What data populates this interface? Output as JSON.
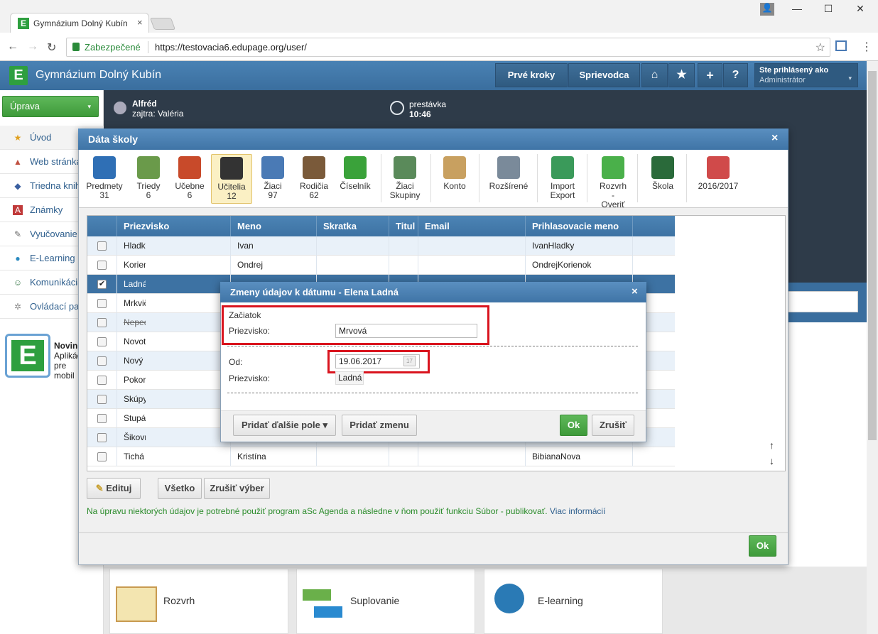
{
  "browser": {
    "tab_title": "Gymnázium Dolný Kubín",
    "tab_close": "×",
    "secure_label": "Zabezpečené",
    "url": "https://testovacia6.edupage.org/user/",
    "minimize": "—",
    "maximize": "☐",
    "close": "✕"
  },
  "header": {
    "logo_letter": "E",
    "title": "Gymnázium Dolný Kubín",
    "first_steps": "Prvé kroky",
    "guide": "Sprievodca",
    "home_icon": "⌂",
    "star_icon": "★",
    "plus_icon": "+",
    "help_icon": "?",
    "logged_as": "Ste prihlásený ako",
    "role": "Administrátor",
    "caret": "▾"
  },
  "sidebar": {
    "edit_button": "Úprava",
    "edit_caret": "▾",
    "items": [
      {
        "label": "Úvod",
        "icon": "★"
      },
      {
        "label": "Web stránka",
        "icon": "▲"
      },
      {
        "label": "Triedna kniha",
        "icon": "◆"
      },
      {
        "label": "Známky",
        "icon": "A"
      },
      {
        "label": "Vyučovanie",
        "icon": "✎"
      },
      {
        "label": "E-Learning",
        "icon": "●"
      },
      {
        "label": "Komunikácia",
        "icon": "☺"
      },
      {
        "label": "Ovládací panel",
        "icon": "✲"
      }
    ],
    "news_title": "Novinky",
    "news_line1": "Aplikácia",
    "news_line2": "pre mobil"
  },
  "backdrop": {
    "user_name": "Alfréd",
    "tomorrow": "zajtra: Valéria",
    "break_label": "prestávka",
    "time": "10:46",
    "tiles": [
      "Rozvrh",
      "Suplovanie",
      "E-learning"
    ]
  },
  "dialog": {
    "title": "Dáta školy",
    "close": "×",
    "toolbar": [
      {
        "label": "Predmety",
        "count": "31",
        "color": "#2f6fb5"
      },
      {
        "label": "Triedy",
        "count": "6",
        "color": "#6a9a4a"
      },
      {
        "label": "Učebne",
        "count": "6",
        "color": "#c84a2a"
      },
      {
        "label": "Učitelia",
        "count": "12",
        "color": "#333333"
      },
      {
        "label": "Žiaci",
        "count": "97",
        "color": "#4a7ab5"
      },
      {
        "label": "Rodičia",
        "count": "62",
        "color": "#7a5a3a"
      },
      {
        "label": "Číselník",
        "count": "",
        "color": "#3aa23a"
      },
      {
        "label": "Žiaci Skupiny",
        "count": "",
        "color": "#5a8a5a"
      },
      {
        "label": "Konto",
        "count": "",
        "color": "#c8a060"
      },
      {
        "label": "Rozšírené",
        "count": "",
        "color": "#7a8a9a"
      },
      {
        "label": "Import Export",
        "count": "",
        "color": "#3a9a5a"
      },
      {
        "label": "Rozvrh - Overiť",
        "count": "",
        "color": "#4ab04a"
      },
      {
        "label": "Škola",
        "count": "",
        "color": "#2a6a3a"
      },
      {
        "label": "2016/2017",
        "count": "",
        "color": "#d04a4a"
      }
    ],
    "columns": [
      "Priezvisko",
      "Meno",
      "Skratka",
      "Titul",
      "Email",
      "Prihlasovacie meno"
    ],
    "rows": [
      {
        "check": "",
        "surname": "Hladký",
        "name": "Ivan",
        "login": "IvanHladky"
      },
      {
        "check": "",
        "surname": "Korienok",
        "name": "Ondrej",
        "login": "OndrejKorienok"
      },
      {
        "check": "✔",
        "surname": "Ladná",
        "name": "",
        "login": ""
      },
      {
        "check": "",
        "surname": "Mrkvička",
        "name": "",
        "login": ""
      },
      {
        "check": "",
        "surname": "Nepedagogický",
        "name": "",
        "login": ""
      },
      {
        "check": "",
        "surname": "Novotný",
        "name": "",
        "login": ""
      },
      {
        "check": "",
        "surname": "Nový",
        "name": "",
        "login": ""
      },
      {
        "check": "",
        "surname": "Pokorný",
        "name": "",
        "login": ""
      },
      {
        "check": "",
        "surname": "Skúpy",
        "name": "",
        "login": ""
      },
      {
        "check": "",
        "surname": "Stupák",
        "name": "",
        "login": ""
      },
      {
        "check": "",
        "surname": "Šikovný",
        "name": "",
        "login": ""
      },
      {
        "check": "",
        "surname": "Tichá",
        "name": "Kristína",
        "login": "BibianaNova"
      }
    ],
    "scroll_up": "↑",
    "scroll_down": "↓",
    "edit_button": "Edituj",
    "select_all": "Všetko",
    "cancel_selection": "Zrušiť výber",
    "note": "Na úpravu niektorých údajov je potrebné použiť program aSc Agenda a následne v ňom použiť funkciu Súbor - publikovať.",
    "note_link": "Viac informácií",
    "ok": "Ok"
  },
  "subdialog": {
    "title": "Zmeny údajov k dátumu - Elena Ladná",
    "close": "×",
    "start_heading": "Začiatok",
    "surname_label": "Priezvisko:",
    "surname_value": "Mrvová",
    "from_label": "Od:",
    "from_value": "19.06.2017",
    "calendar_icon": "17",
    "surname2_label": "Priezvisko:",
    "surname2_value": "Ladná",
    "add_field": "Pridať ďalšie pole ▾",
    "add_change": "Pridať zmenu",
    "ok": "Ok",
    "cancel": "Zrušiť"
  }
}
